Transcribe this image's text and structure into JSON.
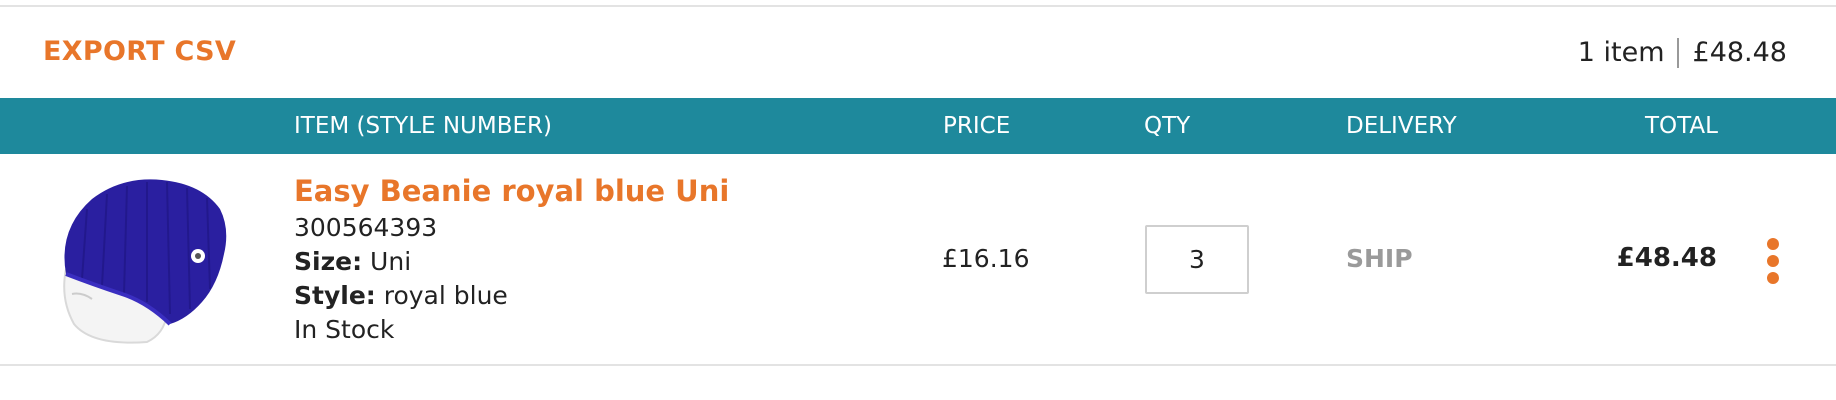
{
  "toolbar": {
    "export_label": "EXPORT CSV",
    "item_count": "1 item",
    "cart_total": "£48.48"
  },
  "table": {
    "columns": {
      "item": "ITEM (STYLE NUMBER)",
      "price": "PRICE",
      "qty": "QTY",
      "delivery": "DELIVERY",
      "total": "TOTAL"
    },
    "rows": [
      {
        "name": "Easy Beanie royal blue Uni",
        "sku": "300564393",
        "size_label": "Size:",
        "size": "Uni",
        "style_label": "Style:",
        "style": "royal blue",
        "stock": "In Stock",
        "price": "£16.16",
        "qty": "3",
        "delivery": "SHIP",
        "total": "£48.48",
        "image_icon": "blue-beanie-product-image",
        "menu_icon": "vertical-ellipsis-icon"
      }
    ]
  },
  "colors": {
    "accent": "#e8762a",
    "header_bg": "#1e899c",
    "muted": "#9a9a9a",
    "beanie": "#2a1fa0"
  }
}
